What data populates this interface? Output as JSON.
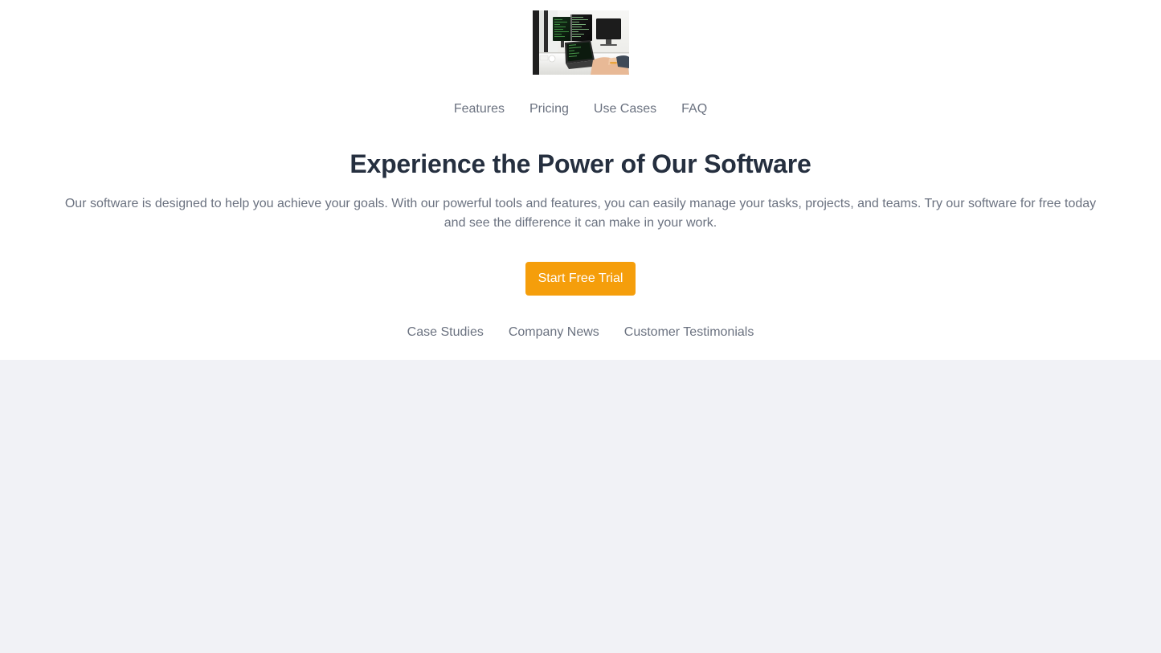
{
  "theme": {
    "panel_bg": "#ffffff",
    "page_bg": "#f1f2f6",
    "accent": "#f59e0b",
    "heading_color": "#252f3f",
    "muted_text": "#6b7280"
  },
  "header": {
    "logo": {
      "alt": "Company logo",
      "icon": "workstation-monitors-photo"
    },
    "nav": [
      {
        "label": "Features"
      },
      {
        "label": "Pricing"
      },
      {
        "label": "Use Cases"
      },
      {
        "label": "FAQ"
      }
    ]
  },
  "hero": {
    "title": "Experience the Power of Our Software",
    "description": "Our software is designed to help you achieve your goals. With our powerful tools and features, you can easily manage your tasks, projects, and teams. Try our software for free today and see the difference it can make in your work.",
    "cta_label": "Start Free Trial"
  },
  "footer": {
    "links": [
      {
        "label": "Case Studies"
      },
      {
        "label": "Company News"
      },
      {
        "label": "Customer Testimonials"
      }
    ]
  }
}
